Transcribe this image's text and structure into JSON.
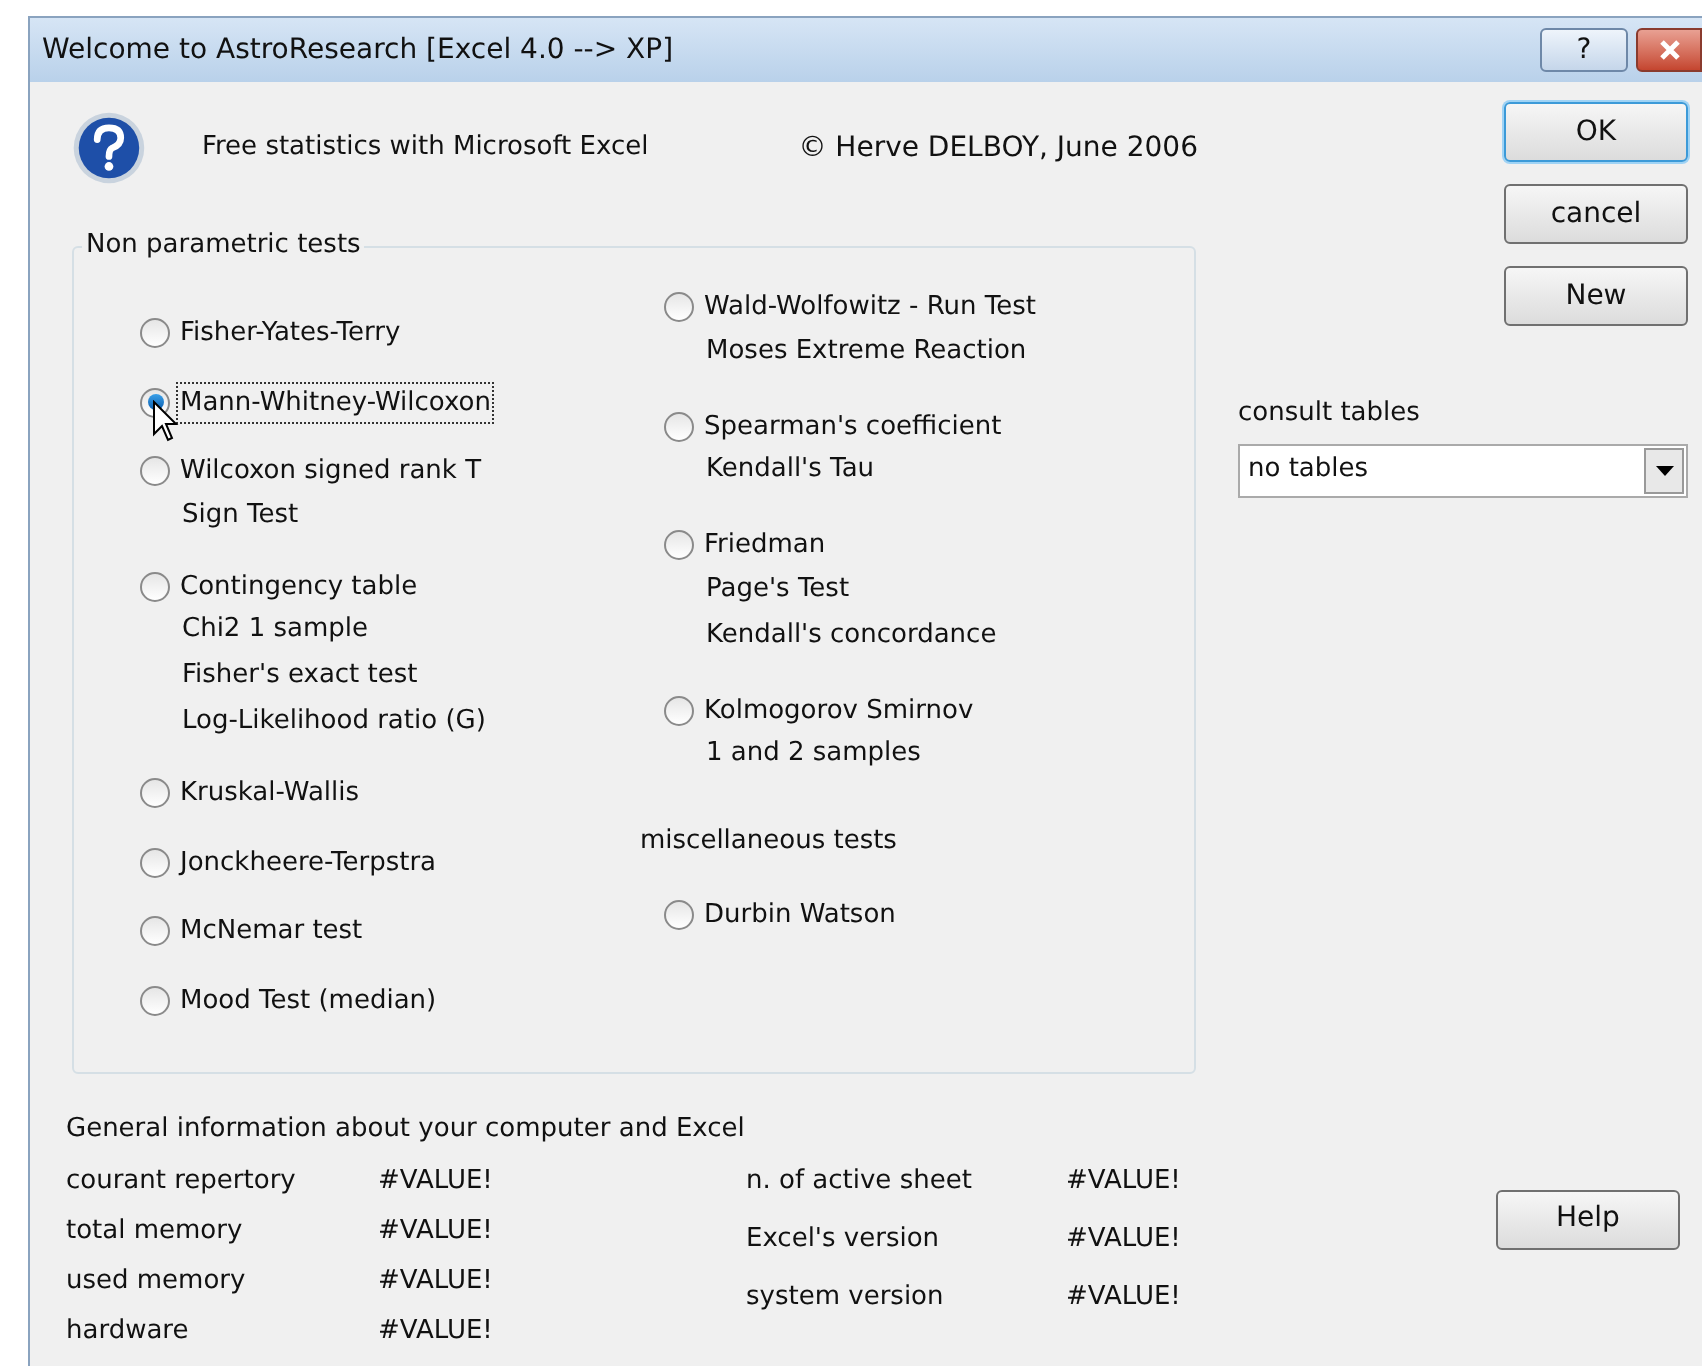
{
  "window": {
    "title": "Welcome to AstroResearch [Excel 4.0 --> XP]",
    "help_glyph": "?"
  },
  "header": {
    "subtitle": "Free statistics with Microsoft Excel",
    "copyright": "© Herve DELBOY, June 2006"
  },
  "group": {
    "legend": "Non parametric tests",
    "columns": [
      [
        {
          "kind": "radio",
          "label": "Fisher-Yates-Terry",
          "selected": false
        },
        {
          "kind": "radio",
          "label": "Mann-Whitney-Wilcoxon",
          "selected": true
        },
        {
          "kind": "radio",
          "label": "Wilcoxon signed rank T",
          "sublabels": [
            "Sign Test"
          ],
          "selected": false
        },
        {
          "kind": "radio",
          "label": "Contingency table",
          "sublabels": [
            "Chi2 1 sample",
            "Fisher's exact test",
            "Log-Likelihood ratio (G)"
          ],
          "selected": false
        },
        {
          "kind": "radio",
          "label": "Kruskal-Wallis",
          "selected": false
        },
        {
          "kind": "radio",
          "label": "Jonckheere-Terpstra",
          "selected": false
        },
        {
          "kind": "radio",
          "label": "McNemar test",
          "selected": false
        },
        {
          "kind": "radio",
          "label": "Mood Test (median)",
          "selected": false
        }
      ],
      [
        {
          "kind": "radio",
          "label": "Wald-Wolfowitz - Run Test",
          "sublabels": [
            "Moses Extreme Reaction"
          ],
          "selected": false
        },
        {
          "kind": "radio",
          "label": "Spearman's coefficient",
          "sublabels": [
            "Kendall's Tau"
          ],
          "selected": false
        },
        {
          "kind": "radio",
          "label": "Friedman",
          "sublabels": [
            "Page's Test",
            "Kendall's concordance"
          ],
          "selected": false
        },
        {
          "kind": "radio",
          "label": "Kolmogorov Smirnov",
          "sublabels": [
            "1 and 2 samples"
          ],
          "selected": false
        },
        {
          "kind": "heading",
          "label": "miscellaneous tests"
        },
        {
          "kind": "radio",
          "label": "Durbin Watson",
          "selected": false
        }
      ]
    ]
  },
  "buttons": [
    {
      "label": "OK",
      "default": true
    },
    {
      "label": "cancel",
      "default": false
    },
    {
      "label": "New",
      "default": false
    }
  ],
  "consult": {
    "label": "consult tables",
    "value": "no tables"
  },
  "info": {
    "title": "General information about your computer and Excel",
    "left": [
      {
        "label": "courant repertory",
        "value": "#VALUE!"
      },
      {
        "label": "total memory",
        "value": "#VALUE!"
      },
      {
        "label": "used memory",
        "value": "#VALUE!"
      },
      {
        "label": "hardware",
        "value": "#VALUE!"
      }
    ],
    "right": [
      {
        "label": "n. of active sheet",
        "value": "#VALUE!"
      },
      {
        "label": "Excel's version",
        "value": "#VALUE!"
      },
      {
        "label": "system version",
        "value": "#VALUE!"
      }
    ]
  },
  "help_button": "Help"
}
